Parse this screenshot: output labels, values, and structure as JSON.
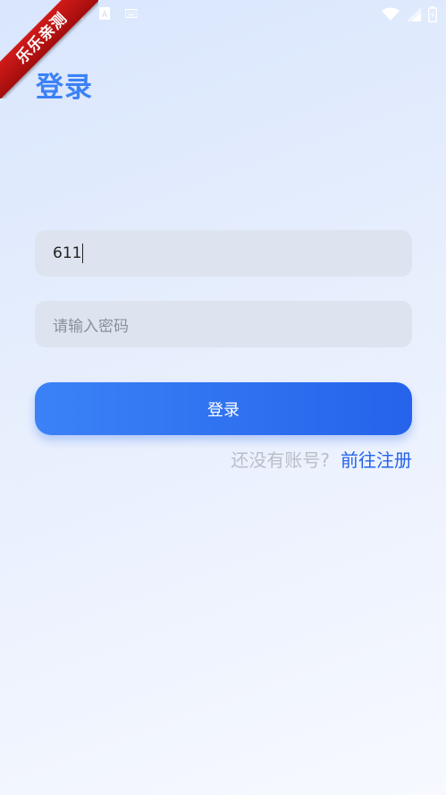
{
  "ribbon": {
    "label": "乐乐亲测"
  },
  "status_bar": {
    "icons_left": [
      "sim-icon",
      "text-a-icon",
      "keyboard-icon"
    ],
    "icons_right": [
      "wifi-icon",
      "signal-icon",
      "battery-icon"
    ]
  },
  "page": {
    "title": "登录"
  },
  "form": {
    "account": {
      "value": "611"
    },
    "password": {
      "placeholder": "请输入密码"
    },
    "submit_label": "登录"
  },
  "register": {
    "question": "还没有账号?",
    "link_label": "前往注册"
  },
  "colors": {
    "accent": "#3b82f6",
    "accent_dark": "#2563eb",
    "ribbon": "#c41414",
    "field_bg": "#dde4ef"
  }
}
